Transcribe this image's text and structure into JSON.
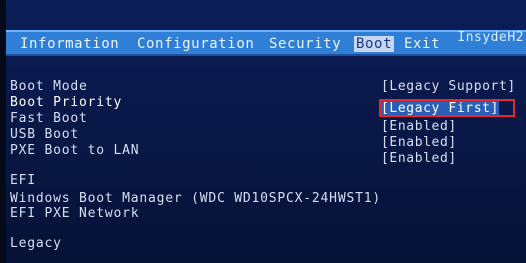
{
  "app": {
    "brand": "InsydeH2"
  },
  "menu": {
    "items": [
      {
        "label": "Information"
      },
      {
        "label": "Configuration"
      },
      {
        "label": "Security"
      },
      {
        "label": "Boot"
      },
      {
        "label": "Exit"
      }
    ],
    "active": "Boot"
  },
  "settings": [
    {
      "label": "Boot Mode",
      "value": "[Legacy Support]"
    },
    {
      "label": "Boot Priority",
      "value": "[Legacy First]"
    },
    {
      "label": "Fast Boot",
      "value": "[Enabled]"
    },
    {
      "label": "USB Boot",
      "value": "[Enabled]"
    },
    {
      "label": "PXE Boot to LAN",
      "value": "[Enabled]"
    }
  ],
  "efi": {
    "header": "EFI",
    "items": [
      "Windows Boot Manager (WDC WD10SPCX-24HWST1)",
      "EFI PXE Network"
    ]
  },
  "legacy": {
    "header": "Legacy"
  },
  "colors": {
    "title_bar": "#2f7fd6",
    "background": "#0b1a4d",
    "annotation_box": "#e2282e"
  }
}
